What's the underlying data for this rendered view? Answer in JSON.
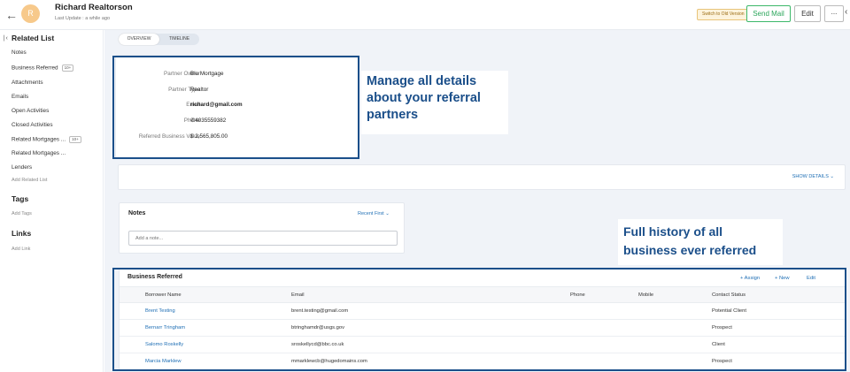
{
  "header": {
    "back_icon": "back-arrow-icon",
    "avatar_initial": "R",
    "record_name": "Richard Realtorson",
    "last_update": "Last Update : a while ago",
    "switch_label": "Switch to Old Version",
    "send_mail_label": "Send Mail",
    "edit_label": "Edit",
    "more_label": "...",
    "collapse_icon": "chevron-left-icon"
  },
  "sidebar": {
    "related_title": "Related List",
    "related_items": [
      {
        "label": "Notes",
        "badge": ""
      },
      {
        "label": "Business Referred",
        "badge": "10+"
      },
      {
        "label": "Attachments",
        "badge": ""
      },
      {
        "label": "Emails",
        "badge": ""
      },
      {
        "label": "Open Activities",
        "badge": ""
      },
      {
        "label": "Closed Activities",
        "badge": ""
      },
      {
        "label": "Related Mortgages ...",
        "badge": "10+"
      },
      {
        "label": "Related Mortgages ...",
        "badge": ""
      },
      {
        "label": "Lenders",
        "badge": ""
      }
    ],
    "add_related": "Add Related List",
    "tags_title": "Tags",
    "add_tags": "Add Tags",
    "links_title": "Links",
    "add_link": "Add Link"
  },
  "tabs": {
    "overview": "OVERVIEW",
    "timeline": "TIMELINE"
  },
  "details": [
    {
      "label": "Partner Owner",
      "value": "Blu Mortgage"
    },
    {
      "label": "Partner Type",
      "value": "Realtor"
    },
    {
      "label": "Email",
      "value": "richard@gmail.com"
    },
    {
      "label": "Phone",
      "value": "4035559382"
    },
    {
      "label": "Referred Business Value",
      "value": "$ 2,565,805.00"
    }
  ],
  "callouts": {
    "details": "Manage all details about your referral partners",
    "history": "Full history of all business ever referred"
  },
  "show_details": "SHOW DETAILS",
  "notes": {
    "title": "Notes",
    "sort_label": "Recent First",
    "placeholder": "Add a note..."
  },
  "business": {
    "title": "Business Referred",
    "assign_label": "+ Assign",
    "new_label": "+ New",
    "edit_label": "Edit",
    "columns": [
      "Borrower Name",
      "Email",
      "Phone",
      "Mobile",
      "Contact Status"
    ],
    "rows": [
      {
        "name": "Brent Testing",
        "email": "brent.testing@gmail.com",
        "phone": "",
        "mobile": "",
        "status": "Potential Client"
      },
      {
        "name": "Bernarr Tringham",
        "email": "btringhamdr@usgs.gov",
        "phone": "",
        "mobile": "",
        "status": "Prospect"
      },
      {
        "name": "Salomo Roskelly",
        "email": "sroskellycd@bbc.co.uk",
        "phone": "",
        "mobile": "",
        "status": "Client"
      },
      {
        "name": "Marcia Marklew",
        "email": "mmarklewcb@hugedomains.com",
        "phone": "",
        "mobile": "",
        "status": "Prospect"
      }
    ]
  },
  "colors": {
    "accent": "#1f6fb5",
    "highlight": "#1b4f8a",
    "send_green": "#2ba65b"
  }
}
